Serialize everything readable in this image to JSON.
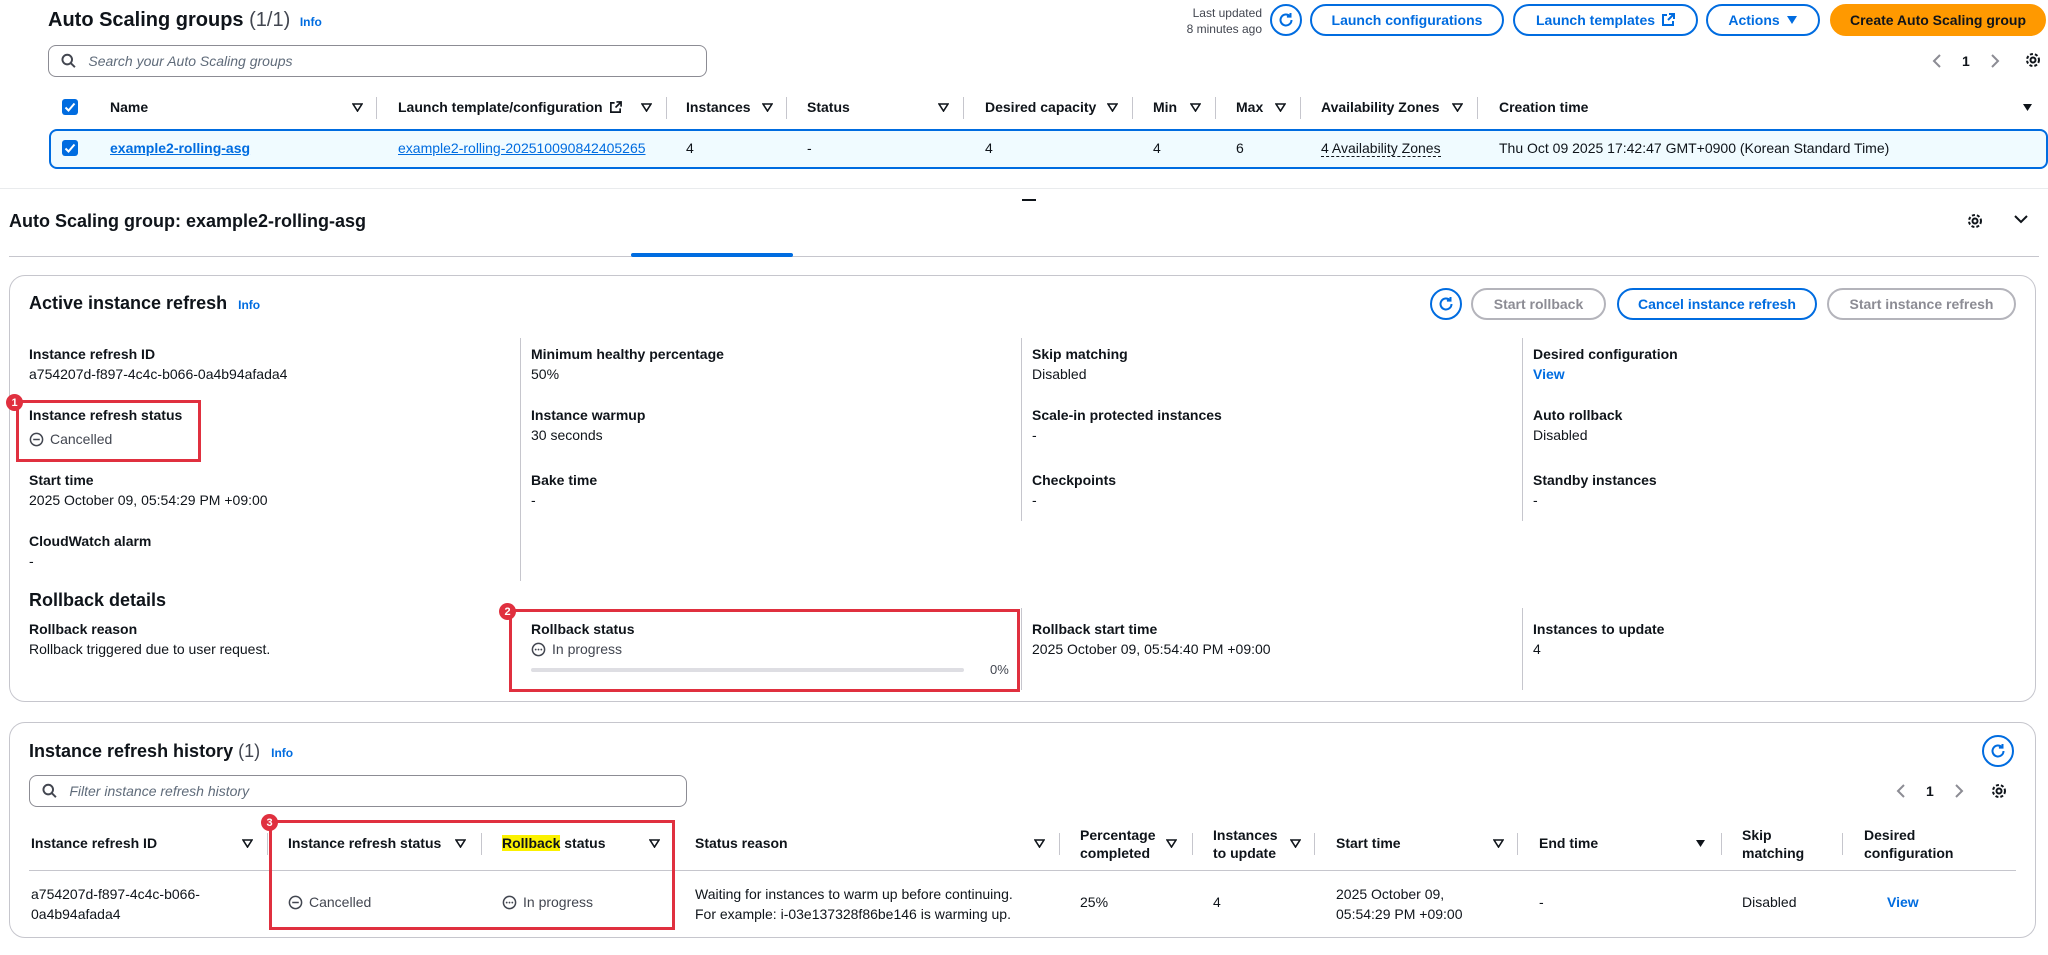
{
  "asg_list": {
    "title": "Auto Scaling groups",
    "count": "(1/1)",
    "info": "Info",
    "last_updated_line1": "Last updated",
    "last_updated_line2": "8 minutes ago",
    "buttons": {
      "launch_configurations": "Launch configurations",
      "launch_templates": "Launch templates",
      "actions": "Actions",
      "create": "Create Auto Scaling group"
    },
    "search_placeholder": "Search your Auto Scaling groups",
    "page": "1",
    "columns": [
      "Name",
      "Launch template/configuration",
      "Instances",
      "Status",
      "Desired capacity",
      "Min",
      "Max",
      "Availability Zones",
      "Creation time"
    ],
    "row": {
      "name": "example2-rolling-asg",
      "launch_template": "example2-rolling-202510090842405265",
      "instances": "4",
      "status": "-",
      "desired": "4",
      "min": "4",
      "max": "6",
      "azs": "4 Availability Zones",
      "creation_time": "Thu Oct 09 2025 17:42:47 GMT+0900 (Korean Standard Time)"
    }
  },
  "detail": {
    "title": "Auto Scaling group: example2-rolling-asg"
  },
  "active_refresh": {
    "title": "Active instance refresh",
    "info": "Info",
    "buttons": {
      "start_rollback": "Start rollback",
      "cancel": "Cancel instance refresh",
      "start_refresh": "Start instance refresh"
    },
    "fields": {
      "refresh_id_label": "Instance refresh ID",
      "refresh_id": "a754207d-f897-4c4c-b066-0a4b94afada4",
      "status_label": "Instance refresh status",
      "status": "Cancelled",
      "start_time_label": "Start time",
      "start_time": "2025 October 09, 05:54:29 PM +09:00",
      "cw_alarm_label": "CloudWatch alarm",
      "cw_alarm": "-",
      "min_healthy_label": "Minimum healthy percentage",
      "min_healthy": "50%",
      "warmup_label": "Instance warmup",
      "warmup": "30 seconds",
      "bake_label": "Bake time",
      "bake": "-",
      "skip_label": "Skip matching",
      "skip": "Disabled",
      "scalein_label": "Scale-in protected instances",
      "scalein": "-",
      "checkpoints_label": "Checkpoints",
      "checkpoints": "-",
      "desired_label": "Desired configuration",
      "desired": "View",
      "auto_rollback_label": "Auto rollback",
      "auto_rollback": "Disabled",
      "standby_label": "Standby instances",
      "standby": "-"
    },
    "rollback": {
      "heading": "Rollback details",
      "reason_label": "Rollback reason",
      "reason": "Rollback triggered due to user request.",
      "status_label": "Rollback status",
      "status": "In progress",
      "progress_text": "0%",
      "progress_fraction": 0,
      "start_label": "Rollback start time",
      "start": "2025 October 09, 05:54:40 PM +09:00",
      "to_update_label": "Instances to update",
      "to_update": "4"
    },
    "badges": [
      "1",
      "2",
      "3"
    ]
  },
  "history": {
    "title": "Instance refresh history",
    "count": "(1)",
    "info": "Info",
    "search_placeholder": "Filter instance refresh history",
    "page": "1",
    "columns": {
      "id": "Instance refresh ID",
      "status": "Instance refresh status",
      "rollback_hl": "Rollback",
      "rollback_rest": " status",
      "reason": "Status reason",
      "pct_1": "Percentage",
      "pct_2": "completed",
      "itu_1": "Instances",
      "itu_2": "to update",
      "start": "Start time",
      "end": "End time",
      "skip_1": "Skip",
      "skip_2": "matching",
      "desired_1": "Desired",
      "desired_2": "configuration"
    },
    "row": {
      "id_1": "a754207d-f897-4c4c-b066-",
      "id_2": "0a4b94afada4",
      "status": "Cancelled",
      "rollback_status": "In progress",
      "reason_1": "Waiting for instances to warm up before continuing.",
      "reason_2": "For example: i-03e137328f86be146 is warming up.",
      "pct": "25%",
      "to_update": "4",
      "start_1": "2025 October 09,",
      "start_2": "05:54:29 PM +09:00",
      "end": "-",
      "skip": "Disabled",
      "desired": "View"
    }
  },
  "colors": {
    "accent": "#006ce0",
    "primary_button": "#ff9900",
    "annotation": "#e0303f",
    "highlight": "#fbf100"
  }
}
